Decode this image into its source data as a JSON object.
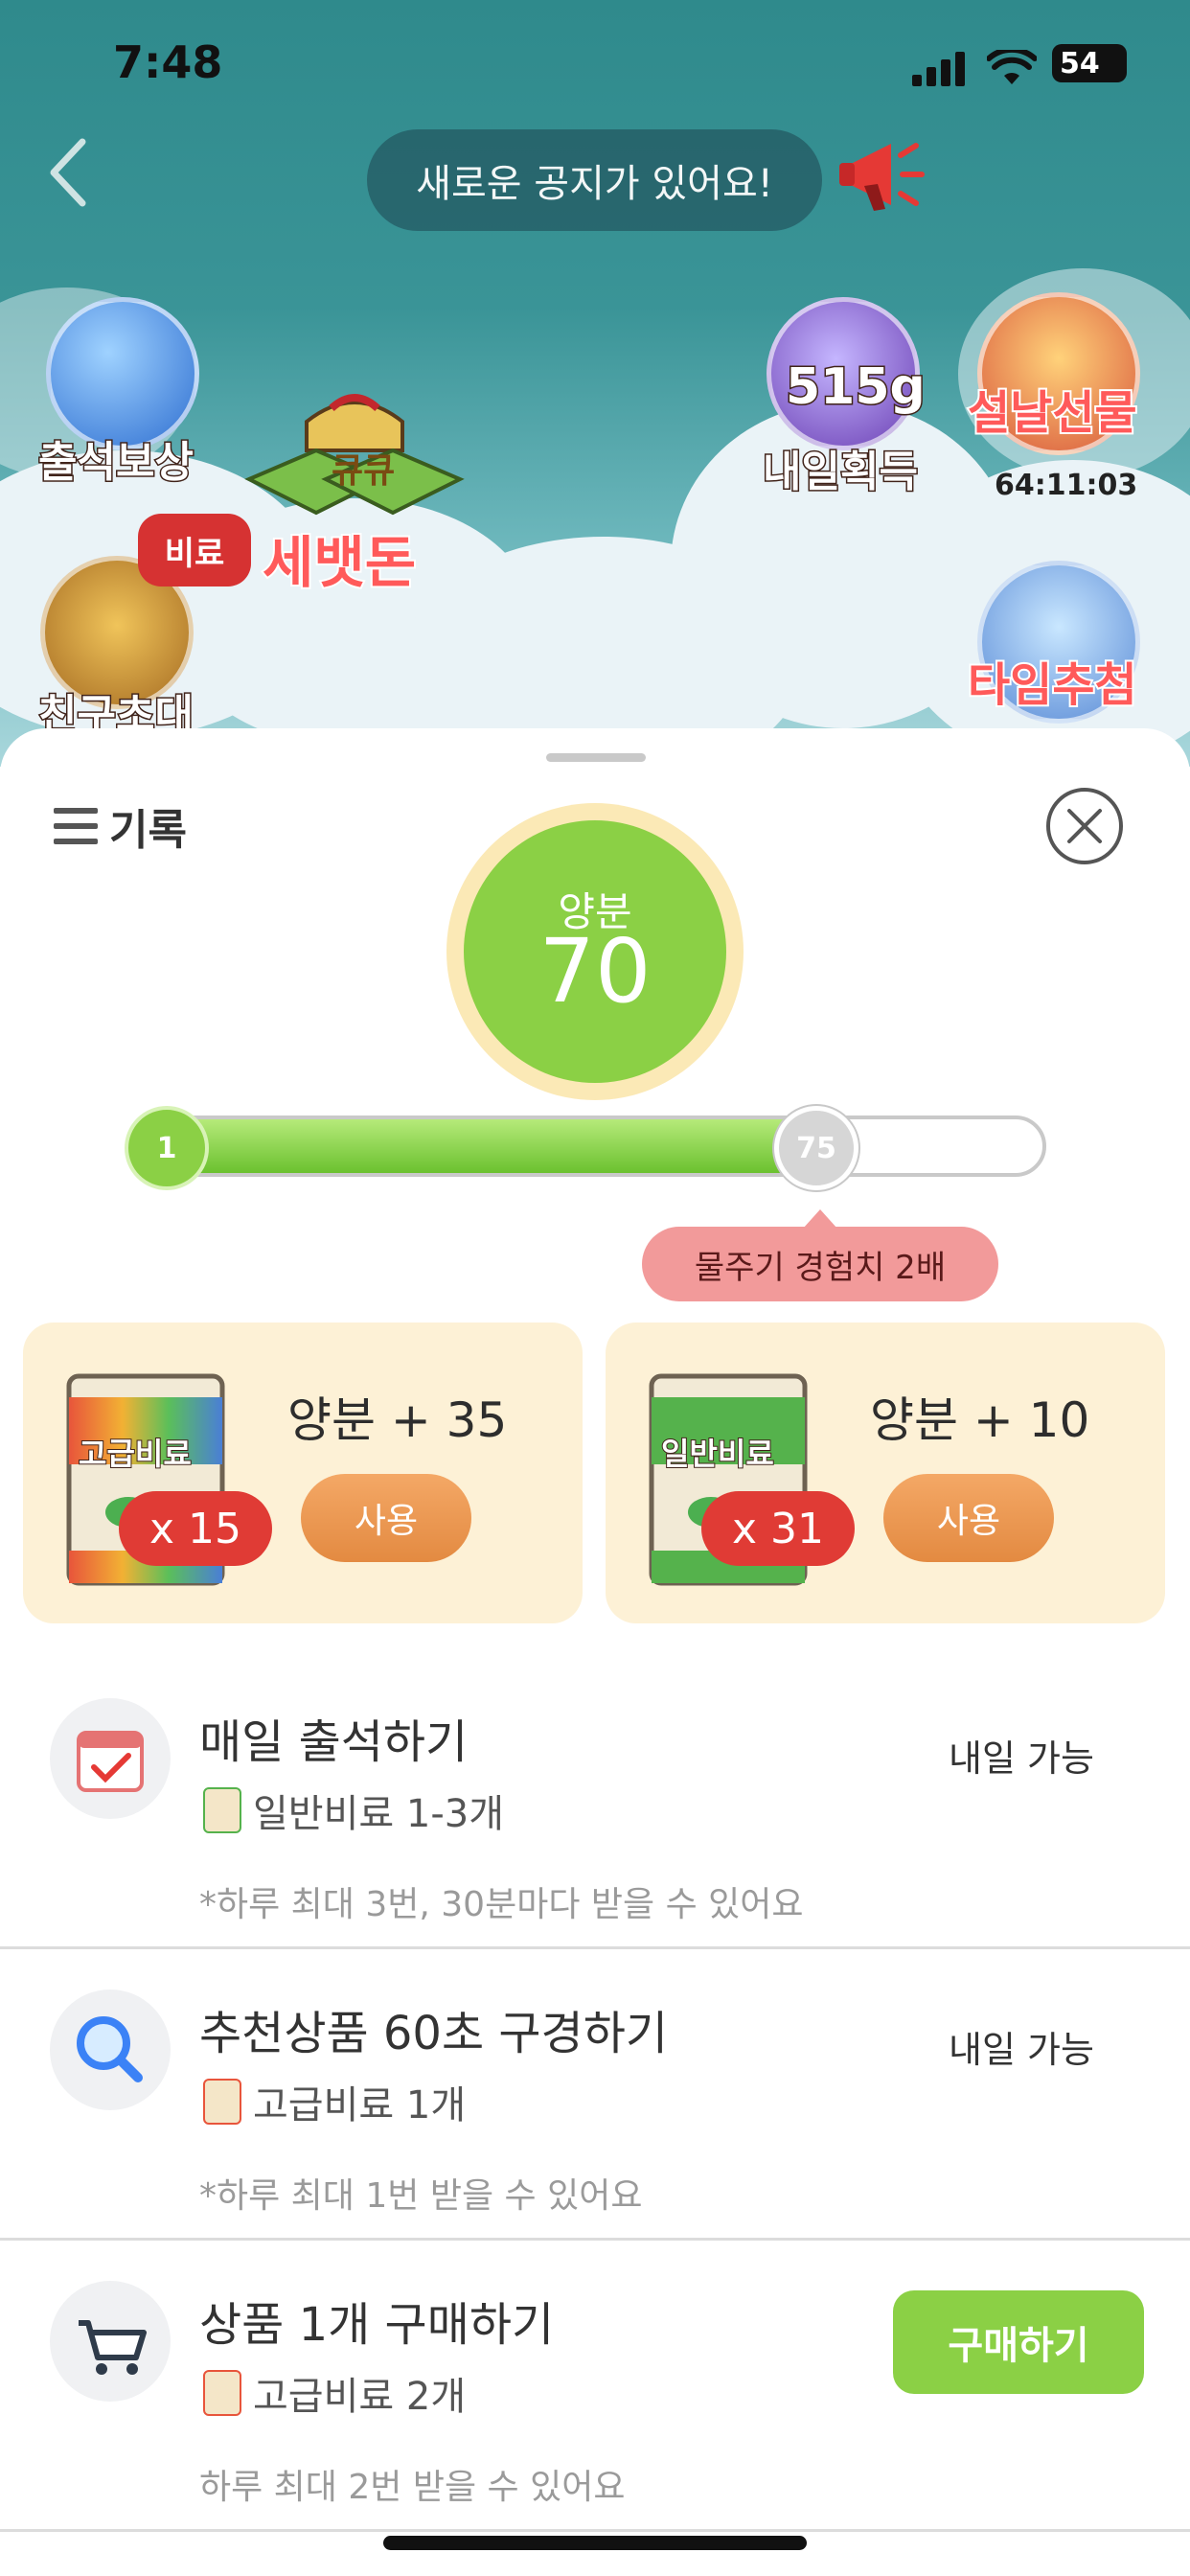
{
  "status_bar": {
    "time": "7:48",
    "battery": "54"
  },
  "notice": {
    "text": "새로운 공지가 있어요!"
  },
  "game_icons": {
    "attendance": "출석보상",
    "sebaetdon": "세뱃돈",
    "sebaetdon_sign": "큐큐",
    "tomorrow_amount": "515g",
    "tomorrow_label": "내일획득",
    "seollal_label": "설날선물",
    "seollal_timer": "64:11:03",
    "invite_label": "친구초대",
    "invite_badge": "비료",
    "time_draw_label": "타임추첨"
  },
  "sheet": {
    "history_label": "기록",
    "nutrient_title": "양분",
    "nutrient_value": "70",
    "progress": {
      "start_label": "1",
      "marker_label": "75",
      "fill_fraction": 0.73
    },
    "tooltip": "물주기 경험치 2배",
    "fertilizers": [
      {
        "bag_label": "고급비료",
        "gain": "양분 + 35",
        "count": "x 15",
        "use_label": "사용"
      },
      {
        "bag_label": "일반비료",
        "gain": "양분 + 10",
        "count": "x 31",
        "use_label": "사용"
      }
    ],
    "tasks": [
      {
        "title": "매일 출석하기",
        "reward": "일반비료 1-3개",
        "note": "*하루 최대 3번, 30분마다 받을 수 있어요",
        "status": "내일 가능"
      },
      {
        "title": "추천상품 60초 구경하기",
        "reward": "고급비료 1개",
        "note": "*하루 최대 1번 받을 수 있어요",
        "status": "내일 가능"
      },
      {
        "title": "상품 1개 구매하기",
        "reward": "고급비료 2개",
        "note": "하루 최대 2번 받을 수 있어요",
        "button": "구매하기"
      }
    ]
  },
  "colors": {
    "accent_green": "#8bd045",
    "count_red": "#e03b35",
    "use_orange": "#e38a41",
    "tooltip_pink": "#f29a9a"
  }
}
